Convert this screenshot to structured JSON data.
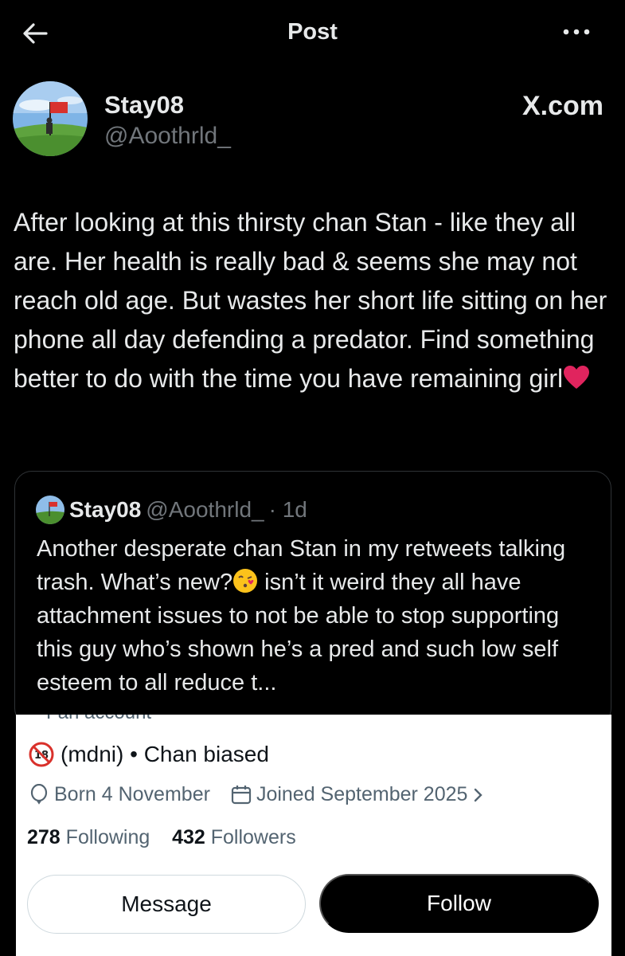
{
  "header": {
    "title": "Post",
    "back_icon": "arrow-left-icon",
    "more_icon": "more-horizontal-icon"
  },
  "post": {
    "author_name": "Stay08",
    "author_handle": "@Aoothrld_",
    "source_label": "X.com",
    "text": "After looking at this thirsty chan Stan - like they all are. Her health is really bad & seems she may not reach old age. But wastes her short life sitting on her phone all day defending a predator. Find something better to do with the time you have remaining girl",
    "emoji": "red-heart"
  },
  "quoted_post": {
    "author_name": "Stay08",
    "author_handle": "@Aoothrld_",
    "time": "· 1d",
    "text_part1": "Another desperate chan Stan in my retweets talking trash. What’s new?",
    "emoji": "face-blowing-kiss",
    "text_part2": " isn’t it weird they all have attachment issues to not be able to stop supporting this guy who’s shown he’s a pred and such low self esteem to all reduce t..."
  },
  "profile_card": {
    "cut_off_text": "Fan account",
    "bio": "(mdni) • Chan biased",
    "bio_icon": "no-one-under-18-icon",
    "birthday": "Born 4 November",
    "joined": "Joined September 2025",
    "following_count": "278",
    "following_label": "Following",
    "followers_count": "432",
    "followers_label": "Followers",
    "message_label": "Message",
    "follow_label": "Follow"
  },
  "colors": {
    "background": "#000000",
    "text": "#e7e9ea",
    "muted": "#71767b",
    "heart": "#e0245e"
  }
}
